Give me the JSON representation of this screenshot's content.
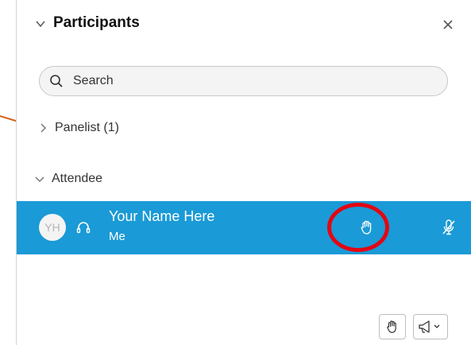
{
  "panel": {
    "title": "Participants",
    "close_label": "×"
  },
  "search": {
    "placeholder": "Search"
  },
  "sections": {
    "panelist": {
      "label": "Panelist (1)"
    },
    "attendee": {
      "label": "Attendee"
    }
  },
  "selected_row": {
    "initials": "YH",
    "name": "Your Name Here",
    "sub": "Me"
  },
  "colors": {
    "row_highlight": "#1a9ad6",
    "annotation_red": "#e30613",
    "annotation_arrow": "#d35f1f"
  },
  "icons": {
    "header": "chevron-down-icon",
    "close": "close-icon",
    "search": "search-icon",
    "headset": "headset-icon",
    "raise_hand": "raise-hand-icon",
    "mic_muted": "mic-muted-icon",
    "megaphone": "megaphone-icon"
  }
}
